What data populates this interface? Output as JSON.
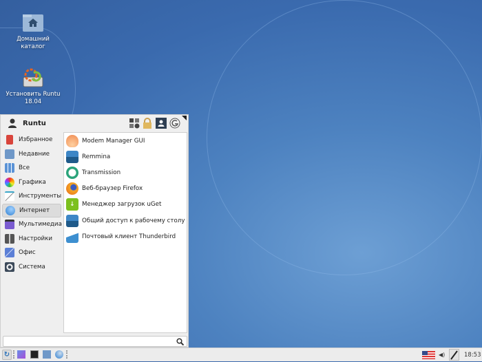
{
  "desktop": {
    "icons": [
      {
        "label": "Домашний каталог",
        "icon": "home-folder-icon"
      },
      {
        "label": "Установить Runtu 18.04",
        "icon": "installer-icon"
      }
    ]
  },
  "menu": {
    "user": "Runtu",
    "header_buttons": [
      "settings-icon",
      "lock-icon",
      "user-switch-icon",
      "logout-icon"
    ],
    "categories": [
      {
        "label": "Избранное",
        "color": "#d9453c"
      },
      {
        "label": "Недавние",
        "color": "#6f98c8"
      },
      {
        "label": "Все",
        "color": "#5b93d6"
      },
      {
        "label": "Графика",
        "color": "#d86a2c"
      },
      {
        "label": "Инструменты",
        "color": "#3aa6c8"
      },
      {
        "label": "Интернет",
        "color": "#2f7fd0",
        "selected": true
      },
      {
        "label": "Мультимедиа",
        "color": "#7a5bd0"
      },
      {
        "label": "Настройки",
        "color": "#555555"
      },
      {
        "label": "Офис",
        "color": "#5b7fd6"
      },
      {
        "label": "Система",
        "color": "#3c4a5a"
      }
    ],
    "apps": [
      {
        "label": "Modem Manager GUI",
        "color": "#f08a50"
      },
      {
        "label": "Remmina",
        "color": "#2b6aa0"
      },
      {
        "label": "Transmission",
        "color": "#2aa37a"
      },
      {
        "label": "Веб-браузер Firefox",
        "color": "#e5681e"
      },
      {
        "label": "Менеджер загрузок uGet",
        "color": "#7cc01e"
      },
      {
        "label": "Общий доступ к рабочему столу",
        "color": "#2b6aa0"
      },
      {
        "label": "Почтовый клиент Thunderbird",
        "color": "#3d8fd0"
      }
    ],
    "search": {
      "value": "",
      "placeholder": ""
    }
  },
  "taskbar": {
    "clock": "18:53",
    "layout": "en-US"
  }
}
